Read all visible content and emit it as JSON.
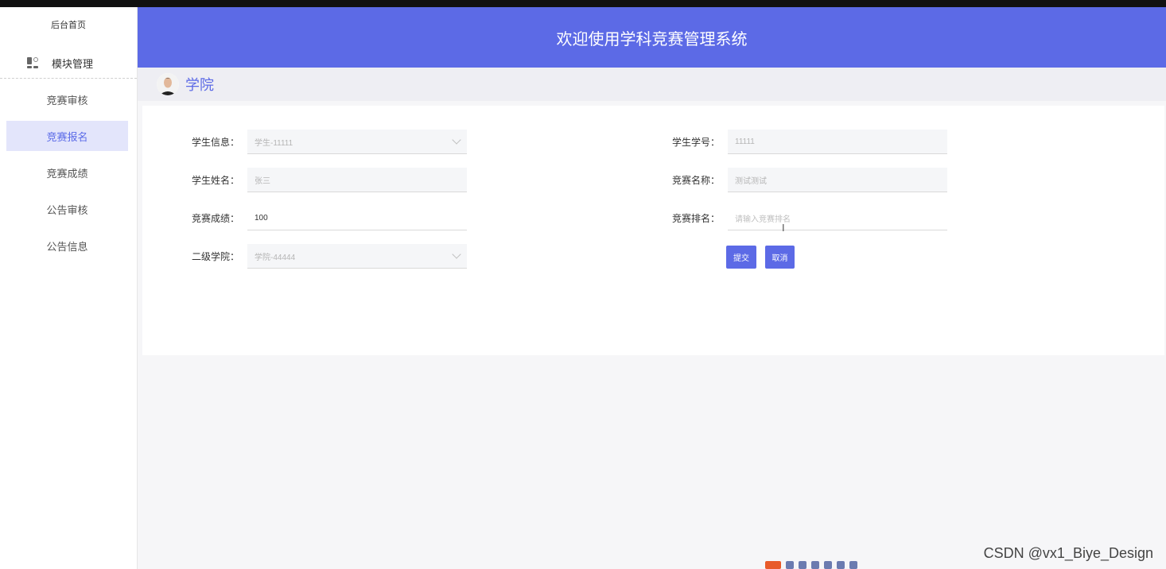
{
  "app": {
    "title": "欢迎使用学科竞赛管理系统"
  },
  "sidebar": {
    "home_label": "后台首页",
    "module_label": "模块管理",
    "items": [
      {
        "label": "竞赛审核"
      },
      {
        "label": "竞赛报名"
      },
      {
        "label": "竞赛成绩"
      },
      {
        "label": "公告审核"
      },
      {
        "label": "公告信息"
      }
    ],
    "active_index": 1
  },
  "crumb": {
    "title": "学院"
  },
  "form": {
    "student_info": {
      "label": "学生信息：",
      "value": "学生-11111"
    },
    "student_id": {
      "label": "学生学号：",
      "value": "11111"
    },
    "student_name": {
      "label": "学生姓名：",
      "value": "张三"
    },
    "contest_name": {
      "label": "竞赛名称：",
      "value": "测试测试"
    },
    "contest_score": {
      "label": "竞赛成绩：",
      "value": "100"
    },
    "contest_rank": {
      "label": "竞赛排名：",
      "placeholder": "请输入竞赛排名"
    },
    "college": {
      "label": "二级学院：",
      "value": "学院-44444"
    },
    "submit_label": "提交",
    "cancel_label": "取消"
  },
  "colors": {
    "primary": "#5c6ae6",
    "active_bg": "#e3e5fb"
  },
  "watermark": "CSDN @vx1_Biye_Design"
}
